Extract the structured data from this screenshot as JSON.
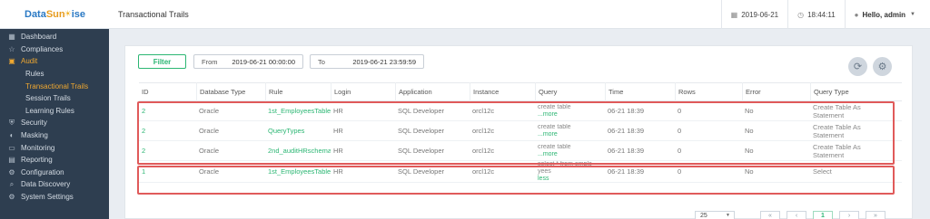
{
  "app": {
    "logo_data": "Data",
    "logo_sun": "Sun",
    "logo_rise": "ise",
    "page_title": "Transactional Trails"
  },
  "header": {
    "date": "2019-06-21",
    "time": "18:44:11",
    "user": "Hello, admin"
  },
  "sidebar": {
    "items": [
      {
        "label": "Dashboard",
        "icon": "grid-icon"
      },
      {
        "label": "Compliances",
        "icon": "star-icon"
      },
      {
        "label": "Audit",
        "icon": "folder-icon"
      },
      {
        "label": "Rules"
      },
      {
        "label": "Transactional Trails"
      },
      {
        "label": "Session Trails"
      },
      {
        "label": "Learning Rules"
      },
      {
        "label": "Security",
        "icon": "shield-icon"
      },
      {
        "label": "Masking",
        "icon": "mask-icon"
      },
      {
        "label": "Monitoring",
        "icon": "monitor-icon"
      },
      {
        "label": "Reporting",
        "icon": "report-icon"
      },
      {
        "label": "Configuration",
        "icon": "config-icon"
      },
      {
        "label": "Data Discovery",
        "icon": "search-icon"
      },
      {
        "label": "System Settings",
        "icon": "gear-icon"
      }
    ]
  },
  "toolbar": {
    "filter_label": "Filter",
    "from_label": "From",
    "from_value": "2019-06-21 00:00:00",
    "to_label": "To",
    "to_value": "2019-06-21 23:59:59"
  },
  "table": {
    "headers": [
      "ID",
      "Database Type",
      "Rule",
      "Login",
      "Application",
      "Instance",
      "Query",
      "Time",
      "Rows",
      "Error",
      "Query Type"
    ],
    "rows": [
      {
        "id": "2",
        "db_type": "Oracle",
        "rule": "1st_EmployeesTable",
        "login": "HR",
        "application": "SQL Developer",
        "instance": "orcl12c",
        "query": "create table",
        "query_link": "...more",
        "time": "06-21 18:39",
        "rows": "0",
        "error": "No",
        "query_type": "Create Table As Statement"
      },
      {
        "id": "2",
        "db_type": "Oracle",
        "rule": "QueryTypes",
        "login": "HR",
        "application": "SQL Developer",
        "instance": "orcl12c",
        "query": "create table",
        "query_link": "...more",
        "time": "06-21 18:39",
        "rows": "0",
        "error": "No",
        "query_type": "Create Table As Statement"
      },
      {
        "id": "2",
        "db_type": "Oracle",
        "rule": "2nd_auditHRschema",
        "login": "HR",
        "application": "SQL Developer",
        "instance": "orcl12c",
        "query": "create table",
        "query_link": "...more",
        "time": "06-21 18:39",
        "rows": "0",
        "error": "No",
        "query_type": "Create Table As Statement"
      },
      {
        "id": "1",
        "db_type": "Oracle",
        "rule": "1st_EmployeesTable",
        "login": "HR",
        "application": "SQL Developer",
        "instance": "orcl12c",
        "query": "select * from emplo yees",
        "query_link": "less",
        "time": "06-21 18:39",
        "rows": "0",
        "error": "No",
        "query_type": "Select"
      }
    ]
  },
  "pagination": {
    "per_page": "25",
    "current_page": "1"
  },
  "colors": {
    "accent_green": "#2bb673",
    "sidebar_bg": "#2e3e50",
    "active_orange": "#f0a830",
    "highlight_red": "#e05a5a"
  }
}
